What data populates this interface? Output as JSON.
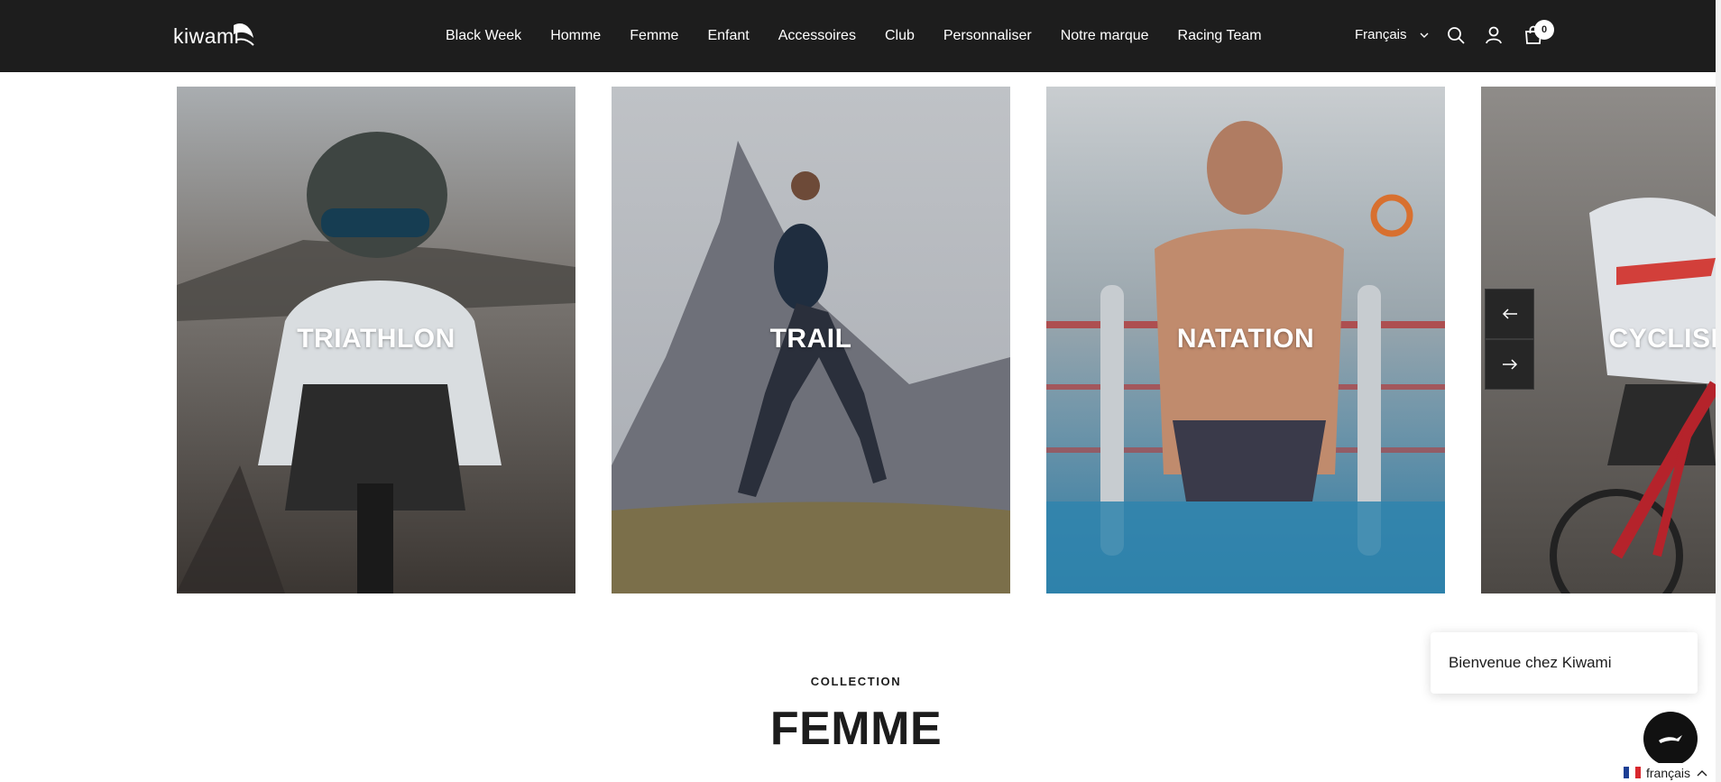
{
  "header": {
    "logo_text": "kiwami",
    "nav": [
      "Black Week",
      "Homme",
      "Femme",
      "Enfant",
      "Accessoires",
      "Club",
      "Personnaliser",
      "Notre marque",
      "Racing Team"
    ],
    "language": "Français",
    "cart_count": "0",
    "icons": [
      "search-icon",
      "account-icon",
      "cart-icon",
      "chevron-down-icon"
    ]
  },
  "categories": [
    {
      "label": "TRIATHLON"
    },
    {
      "label": "TRAIL"
    },
    {
      "label": "NATATION"
    },
    {
      "label": "CYCLISME"
    }
  ],
  "carousel": {
    "prev_icon": "arrow-left-icon",
    "next_icon": "arrow-right-icon"
  },
  "collection": {
    "eyebrow": "COLLECTION",
    "title": "FEMME"
  },
  "chat": {
    "welcome": "Bienvenue chez Kiwami"
  },
  "language_switcher": {
    "label": "français",
    "icon": "chevron-up-icon"
  },
  "colors": {
    "header_bg": "#1d1d1d",
    "text": "#1c1c1c",
    "white": "#ffffff"
  }
}
